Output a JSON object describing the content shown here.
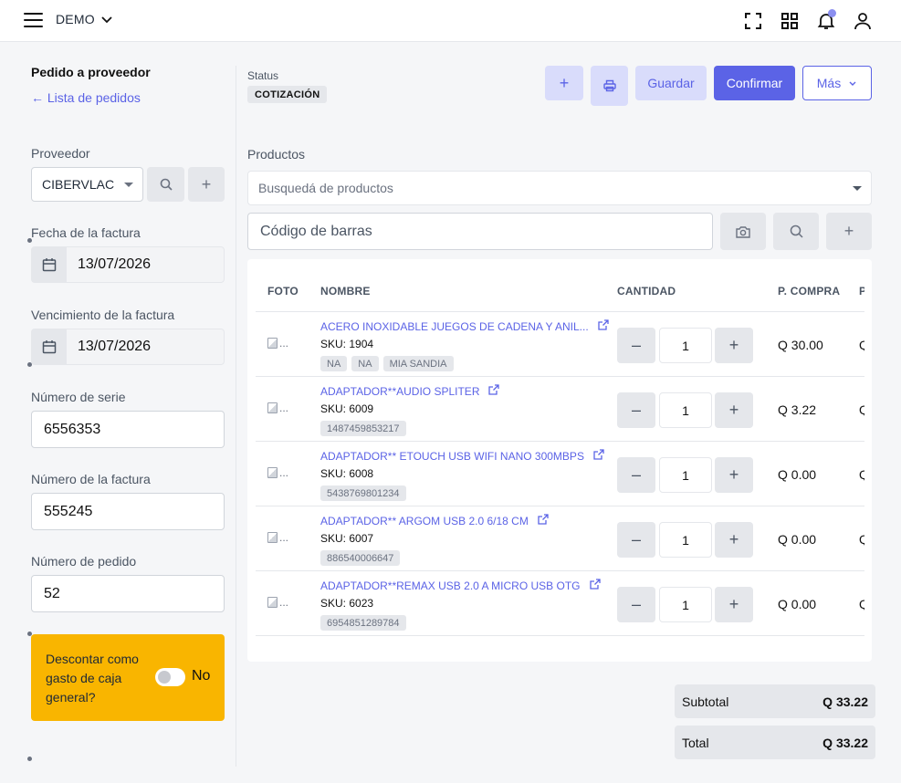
{
  "topbar": {
    "brand": "DEMO",
    "icons": [
      "menu-icon",
      "fullscreen-icon",
      "grid-icon",
      "bell-icon",
      "user-icon"
    ]
  },
  "sidebar": {
    "title": "Pedido a proveedor",
    "back_link": "Lista de pedidos",
    "proveedor_label": "Proveedor",
    "proveedor_value": "CIBERVLAC",
    "fecha_factura_label": "Fecha de la factura",
    "fecha_factura_value": "13/07/2026",
    "vencimiento_label": "Vencimiento de la factura",
    "vencimiento_value": "13/07/2026",
    "serie_label": "Número de serie",
    "serie_value": "6556353",
    "factura_label": "Número de la factura",
    "factura_value": "555245",
    "pedido_label": "Número de pedido",
    "pedido_value": "52",
    "descontar_text": "Descontar como gasto de caja general?",
    "descontar_toggle": "No"
  },
  "status": {
    "label": "Status",
    "value": "COTIZACIÓN"
  },
  "actions": {
    "add": "+",
    "guardar": "Guardar",
    "confirmar": "Confirmar",
    "mas": "Más"
  },
  "products": {
    "label": "Productos",
    "search_placeholder": "Busquedá de productos",
    "barcode_placeholder": "Código de barras",
    "columns": {
      "foto": "FOTO",
      "nombre": "NOMBRE",
      "cantidad": "CANTIDAD",
      "precio": "P. COMPRA",
      "clip": "P"
    },
    "rows": [
      {
        "photo": "...",
        "name": "ACERO INOXIDABLE JUEGOS DE CADENA Y ANIL...",
        "sku": "SKU: 1904",
        "tags": [
          "NA",
          "NA",
          "MIA SANDIA"
        ],
        "qty": "1",
        "price": "Q 30.00",
        "clip": "Q"
      },
      {
        "photo": "...",
        "name": "ADAPTADOR**AUDIO SPLITER",
        "sku": "SKU: 6009",
        "tags": [
          "1487459853217"
        ],
        "qty": "1",
        "price": "Q 3.22",
        "clip": "Q"
      },
      {
        "photo": "...",
        "name": "ADAPTADOR** ETOUCH USB WIFI NANO 300MBPS",
        "sku": "SKU: 6008",
        "tags": [
          "5438769801234"
        ],
        "qty": "1",
        "price": "Q 0.00",
        "clip": "Q"
      },
      {
        "photo": "...",
        "name": "ADAPTADOR** ARGOM USB 2.0 6/18 CM",
        "sku": "SKU: 6007",
        "tags": [
          "886540006647"
        ],
        "qty": "1",
        "price": "Q 0.00",
        "clip": "Q"
      },
      {
        "photo": "...",
        "name": "ADAPTADOR**REMAX USB 2.0 A MICRO USB OTG",
        "sku": "SKU: 6023",
        "tags": [
          "6954851289784"
        ],
        "qty": "1",
        "price": "Q 0.00",
        "clip": "Q"
      }
    ]
  },
  "totals": {
    "subtotal_label": "Subtotal",
    "subtotal_value": "Q 33.22",
    "total_label": "Total",
    "total_value": "Q 33.22"
  },
  "colors": {
    "primary": "#5b63e6",
    "primary_light": "#d9dcfb",
    "warning": "#f9b500"
  }
}
